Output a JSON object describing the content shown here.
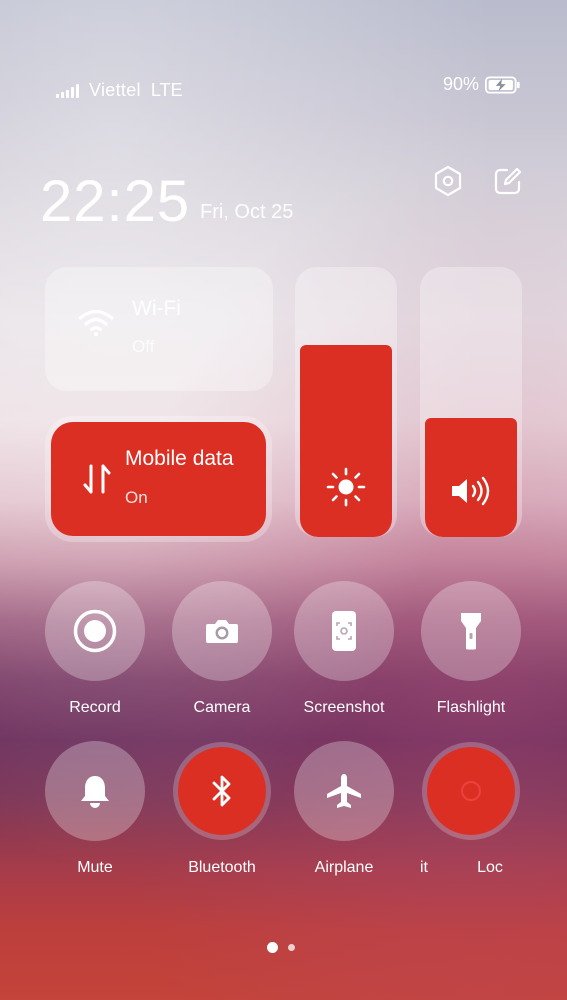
{
  "status_bar": {
    "carrier": "Viettel",
    "network": "LTE",
    "battery_percent": "90%",
    "battery_level": 0.9,
    "charging": true,
    "signal_bars": 5
  },
  "header": {
    "time": "22:25",
    "date": "Fri, Oct 25",
    "settings_icon": "hexagon-settings-icon",
    "edit_icon": "edit-icon"
  },
  "tiles": {
    "wifi": {
      "title": "Wi-Fi",
      "state": "Off",
      "active": false
    },
    "mobile_data": {
      "title": "Mobile data",
      "state": "On",
      "active": true
    }
  },
  "sliders": {
    "brightness": {
      "icon": "sun-icon",
      "level": 0.71
    },
    "volume": {
      "icon": "speaker-icon",
      "level": 0.44
    }
  },
  "toggles": [
    {
      "label": "Record",
      "icon": "record-icon",
      "active": false
    },
    {
      "label": "Camera",
      "icon": "camera-icon",
      "active": false
    },
    {
      "label": "Screenshot",
      "icon": "screenshot-icon",
      "active": false
    },
    {
      "label": "Flashlight",
      "icon": "flashlight-icon",
      "active": false
    },
    {
      "label": "Mute",
      "icon": "bell-icon",
      "active": false
    },
    {
      "label": "Bluetooth",
      "icon": "bluetooth-icon",
      "active": true
    },
    {
      "label": "Airplane",
      "icon": "airplane-icon",
      "active": false
    },
    {
      "label": "it",
      "icon": "",
      "active": true
    },
    {
      "label": "Loc",
      "icon": "",
      "active": false
    }
  ],
  "pager": {
    "pages": 2,
    "current": 1
  },
  "colors": {
    "accent": "#dc2f24"
  }
}
